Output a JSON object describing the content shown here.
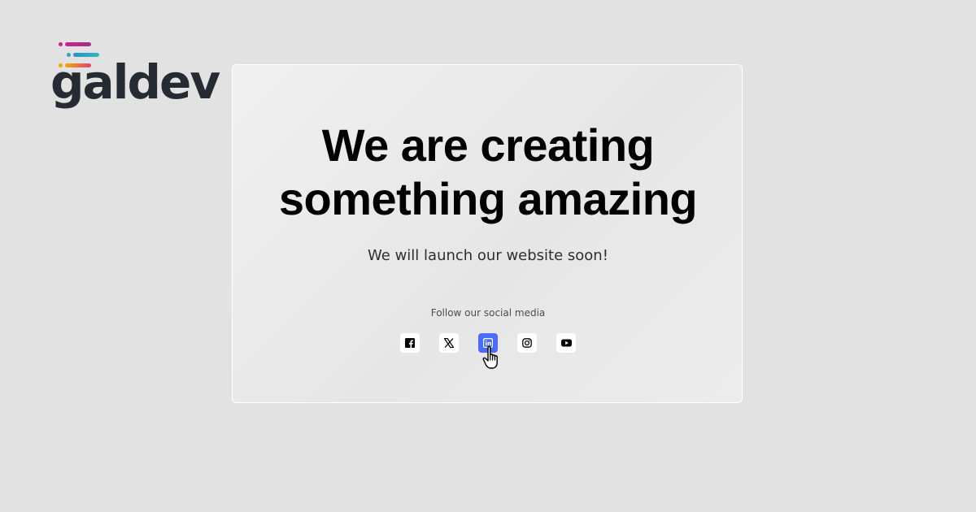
{
  "brand": {
    "name": "galdev",
    "stripe_colors": [
      "#c2258f",
      "#2fa6c6",
      "#f2a900"
    ]
  },
  "hero": {
    "headline_line1": "We are creating",
    "headline_line2": "something amazing",
    "subtitle": "We will launch our website soon!",
    "follow_label": "Follow our social media"
  },
  "social_links": [
    {
      "name": "facebook",
      "icon": "facebook-icon",
      "active": false
    },
    {
      "name": "x",
      "icon": "x-twitter-icon",
      "active": false
    },
    {
      "name": "linkedin",
      "icon": "linkedin-icon",
      "active": true
    },
    {
      "name": "instagram",
      "icon": "instagram-icon",
      "active": false
    },
    {
      "name": "youtube",
      "icon": "youtube-icon",
      "active": false
    }
  ],
  "colors": {
    "background": "#e2e2e2",
    "text": "#000000",
    "logo_text": "#262b33",
    "active_social": "#4a6cf7"
  }
}
